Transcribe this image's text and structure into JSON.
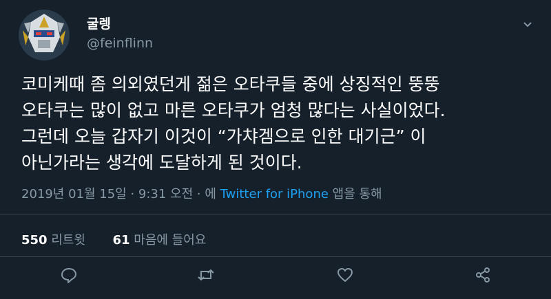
{
  "user": {
    "name": "굴렝",
    "handle": "@feinflinn"
  },
  "tweet": {
    "lines": [
      "코미케때 좀 의외였던게 젊은 오타쿠들 중에 상징적인 뚱뚱",
      "오타쿠는 많이 없고 마른 오타쿠가 엄청 많다는 사실이었다.",
      "그런데 오늘 갑자기 이것이 “가챠겜으로 인한 대기근” 이",
      "아닌가라는 생각에 도달하게 된 것이다."
    ]
  },
  "meta": {
    "datetime": "2019년 01월 15일 · 9:31 오전 · ",
    "via_prefix": "에 ",
    "source": "Twitter for iPhone",
    "via_suffix": " 앱을 통해"
  },
  "stats": {
    "retweets_count": "550",
    "retweets_label": "리트윗",
    "likes_count": "61",
    "likes_label": "마음에 들어요"
  },
  "colors": {
    "background": "#15202b",
    "secondary_text": "#8899a6",
    "link": "#1da1f2",
    "divider": "#38444d"
  },
  "icons": [
    "menu-chevron-icon",
    "reply-icon",
    "retweet-icon",
    "like-icon",
    "share-icon"
  ]
}
